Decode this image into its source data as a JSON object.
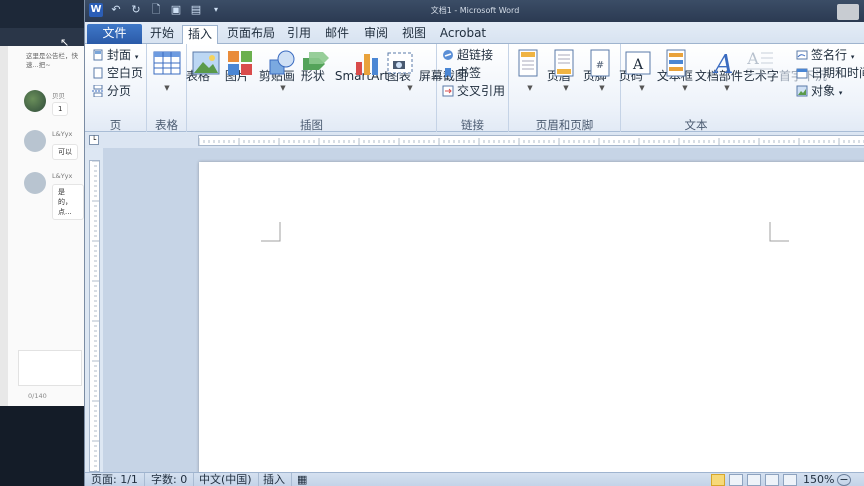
{
  "background_app": {
    "notice": "这里是公告栏，快速...把~",
    "msg1_name": "贝贝",
    "msg1_text": "1",
    "msg2_name": "L&Yyx",
    "msg2_text": "可以",
    "msg3_name": "L&Yyx",
    "msg3_text": "是的，点...",
    "counter": "0/140"
  },
  "window": {
    "title": "文档1 - Microsoft Word"
  },
  "tabs": {
    "file": "文件",
    "home": "开始",
    "insert": "插入",
    "layout": "页面布局",
    "references": "引用",
    "mailings": "邮件",
    "review": "审阅",
    "view": "视图",
    "acrobat": "Acrobat"
  },
  "ribbon": {
    "pages": {
      "label": "页",
      "cover": "封面",
      "blank": "空白页",
      "break": "分页"
    },
    "tables": {
      "label": "表格",
      "table": "表格"
    },
    "illustrations": {
      "label": "插图",
      "picture": "图片",
      "clipart": "剪贴画",
      "shapes": "形状",
      "smartart": "SmartArt",
      "chart": "图表",
      "screenshot": "屏幕截图"
    },
    "links": {
      "label": "链接",
      "hyperlink": "超链接",
      "bookmark": "书签",
      "crossref": "交叉引用"
    },
    "header_footer": {
      "label": "页眉和页脚",
      "header": "页眉",
      "footer": "页脚",
      "page_number": "页码"
    },
    "text": {
      "label": "文本",
      "textbox": "文本框",
      "quickparts": "文档部件",
      "wordart": "艺术字",
      "dropcap": "首字下沉",
      "signature": "签名行",
      "datetime": "日期和时间",
      "object": "对象"
    }
  },
  "status": {
    "page": "页面: 1/1",
    "words": "字数: 0",
    "language": "中文(中国)",
    "mode": "插入",
    "zoom": "150%"
  },
  "colors": {
    "accent": "#2a5aa8",
    "ribbon_bg": "#eef3fa"
  }
}
